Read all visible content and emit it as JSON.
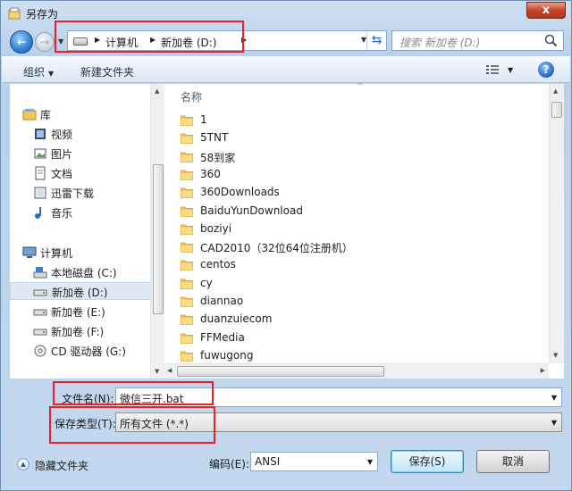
{
  "window": {
    "title": "另存为",
    "close": "x"
  },
  "address": {
    "crumbs": [
      "计算机",
      "新加卷 (D:)"
    ],
    "search_placeholder": "搜索 新加卷 (D:)"
  },
  "toolbar": {
    "organize": "组织",
    "new_folder": "新建文件夹",
    "help": "?"
  },
  "nav": {
    "library": "库",
    "library_items": [
      "视频",
      "图片",
      "文档",
      "迅雷下载",
      "音乐"
    ],
    "computer": "计算机",
    "drives": [
      "本地磁盘 (C:)",
      "新加卷 (D:)",
      "新加卷 (E:)",
      "新加卷 (F:)",
      "CD 驱动器 (G:)"
    ],
    "selected_drive": "新加卷 (D:)"
  },
  "files": {
    "column_name": "名称",
    "items": [
      "1",
      "5TNT",
      "58到家",
      "360",
      "360Downloads",
      "BaiduYunDownload",
      "boziyi",
      "CAD2010（32位64位注册机）",
      "centos",
      "cy",
      "diannao",
      "duanzuiecom",
      "FFMedia",
      "fuwugong"
    ]
  },
  "form": {
    "filename_label": "文件名(N):",
    "filename_value": "微信三开.bat",
    "filetype_label": "保存类型(T):",
    "filetype_value": "所有文件  (*.*)",
    "encoding_label": "编码(E):",
    "encoding_value": "ANSI"
  },
  "buttons": {
    "save": "保存(S)",
    "cancel": "取消",
    "hide_folders": "隐藏文件夹"
  },
  "colors": {
    "highlight": "#e8202a",
    "accent": "#2f7fd0"
  }
}
